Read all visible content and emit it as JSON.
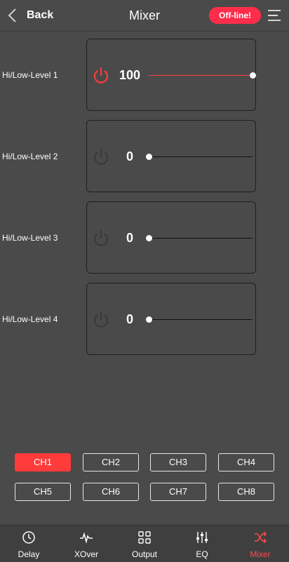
{
  "header": {
    "back_label": "Back",
    "title": "Mixer",
    "status": "Off-line!"
  },
  "levels": [
    {
      "label": "Hi/Low-Level 1",
      "value": "100",
      "fraction": 1.0,
      "enabled": true
    },
    {
      "label": "Hi/Low-Level 2",
      "value": "0",
      "fraction": 0.0,
      "enabled": false
    },
    {
      "label": "Hi/Low-Level 3",
      "value": "0",
      "fraction": 0.0,
      "enabled": false
    },
    {
      "label": "Hi/Low-Level 4",
      "value": "0",
      "fraction": 0.0,
      "enabled": false
    }
  ],
  "channels": [
    "CH1",
    "CH2",
    "CH3",
    "CH4",
    "CH5",
    "CH6",
    "CH7",
    "CH8"
  ],
  "active_channel": "CH1",
  "nav": [
    {
      "label": "Delay",
      "icon": "clock-icon"
    },
    {
      "label": "XOver",
      "icon": "waveform-icon"
    },
    {
      "label": "Output",
      "icon": "grid-icon"
    },
    {
      "label": "EQ",
      "icon": "sliders-icon"
    },
    {
      "label": "Mixer",
      "icon": "shuffle-icon",
      "active": true
    }
  ],
  "colors": {
    "accent": "#ff3b3b",
    "badge": "#ff2d4a",
    "background": "#4a4a4a",
    "icon_inactive": "#3a3a3a"
  }
}
